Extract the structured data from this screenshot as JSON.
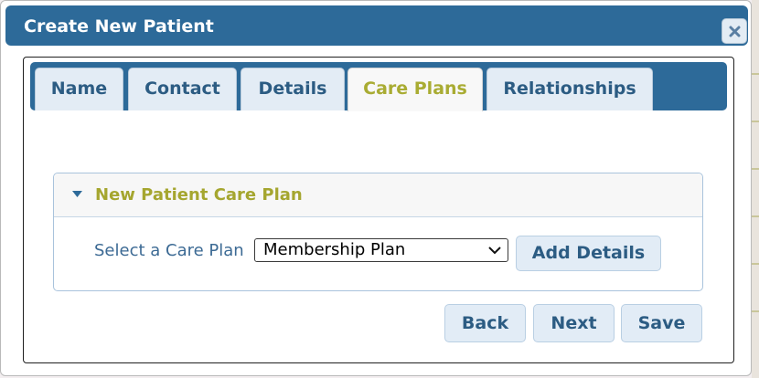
{
  "dialog": {
    "title": "Create New Patient",
    "close_icon": "close-icon"
  },
  "tabs": [
    {
      "label": "Name",
      "active": false
    },
    {
      "label": "Contact",
      "active": false
    },
    {
      "label": "Details",
      "active": false
    },
    {
      "label": "Care Plans",
      "active": true
    },
    {
      "label": "Relationships",
      "active": false
    }
  ],
  "care_plan_section": {
    "title": "New Patient Care Plan",
    "expanded": true,
    "select_label": "Select a Care Plan",
    "selected_plan": "Membership Plan",
    "add_details_label": "Add Details"
  },
  "footer": {
    "back_label": "Back",
    "next_label": "Next",
    "save_label": "Save"
  },
  "colors": {
    "header_blue": "#2d6a99",
    "accent_olive": "#a9ac33",
    "button_text": "#2c5c83"
  }
}
